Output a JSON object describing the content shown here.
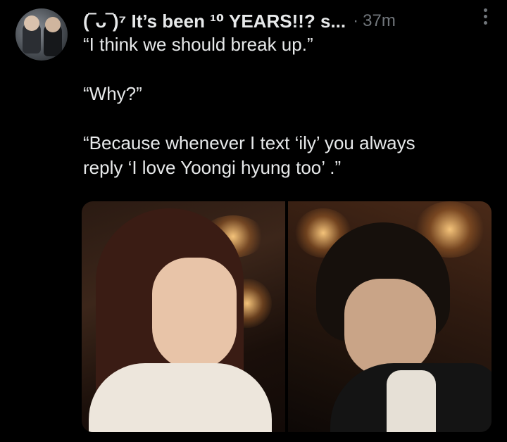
{
  "tweet": {
    "display_name": "(‾ᴗ‾)⁷ It’s been ¹⁰ YEARS!!? s...",
    "separator": "·",
    "timestamp": "37m",
    "text_lines": [
      "“I think we should break up.”",
      "“Why?”",
      "“Because whenever I text ‘ily’ you always",
      "reply ‘I love Yoongi hyung too’ .”"
    ]
  },
  "icons": {
    "more": "more-vertical-icon"
  }
}
